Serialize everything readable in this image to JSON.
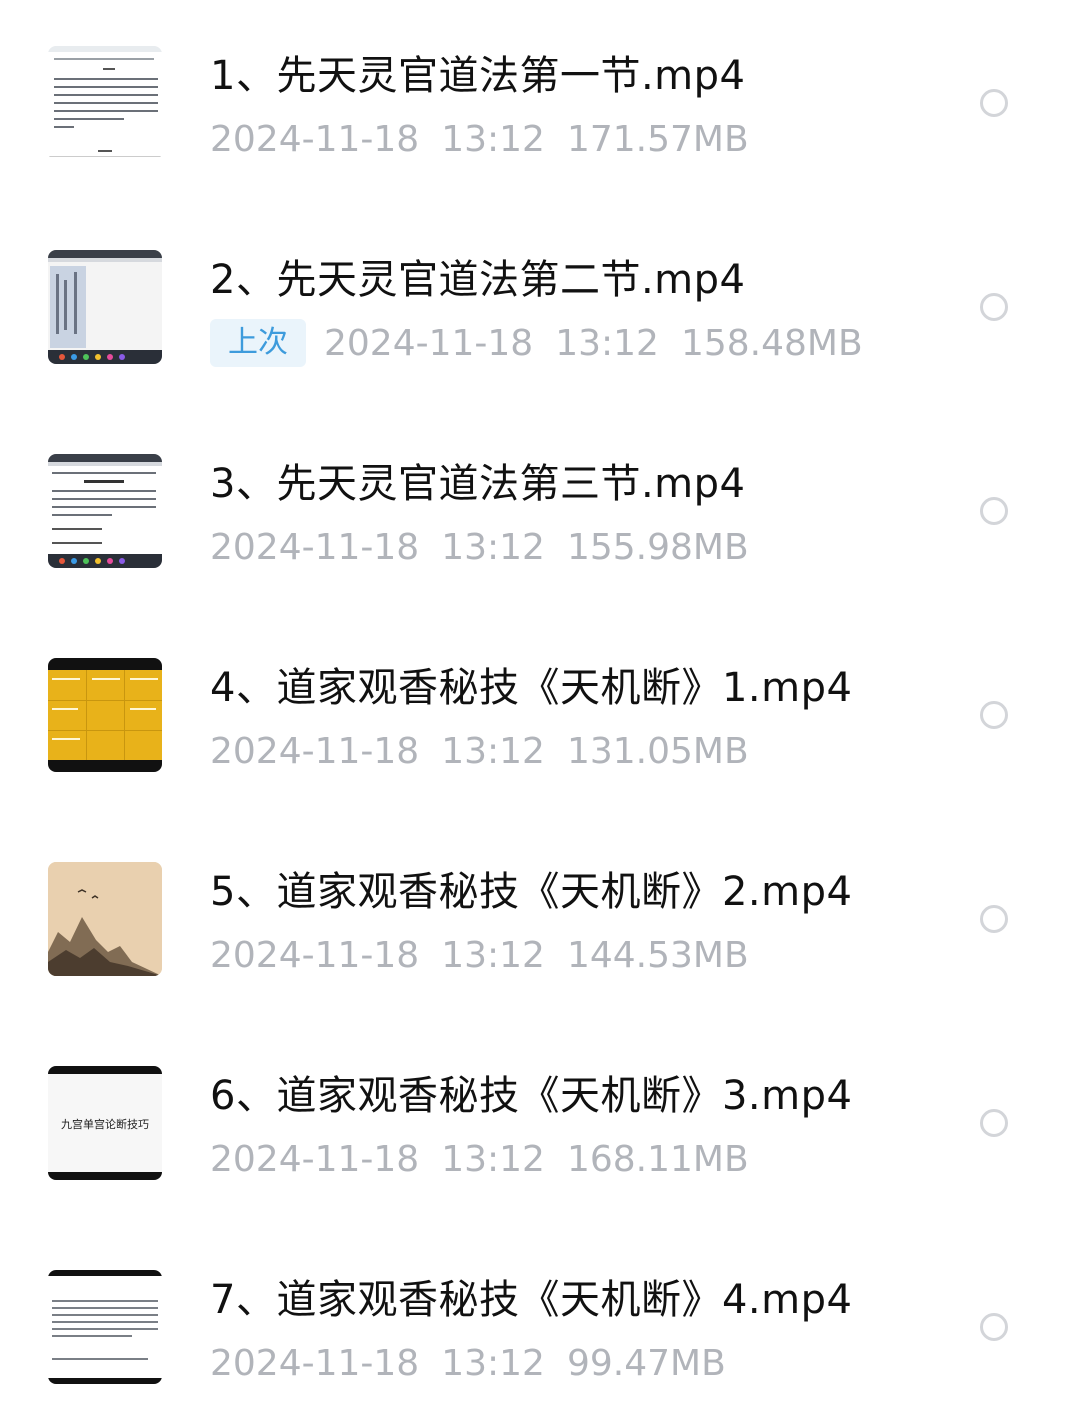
{
  "files": [
    {
      "name": "1、先天灵官道法第一节.mp4",
      "date": "2024-11-18",
      "time": "13:12",
      "size": "171.57MB"
    },
    {
      "name": "2、先天灵官道法第二节.mp4",
      "badge": "上次",
      "date": "2024-11-18",
      "time": "13:12",
      "size": "158.48MB"
    },
    {
      "name": "3、先天灵官道法第三节.mp4",
      "date": "2024-11-18",
      "time": "13:12",
      "size": "155.98MB"
    },
    {
      "name": "4、道家观香秘技《天机断》1.mp4",
      "date": "2024-11-18",
      "time": "13:12",
      "size": "131.05MB"
    },
    {
      "name": "5、道家观香秘技《天机断》2.mp4",
      "date": "2024-11-18",
      "time": "13:12",
      "size": "144.53MB"
    },
    {
      "name": "6、道家观香秘技《天机断》3.mp4",
      "date": "2024-11-18",
      "time": "13:12",
      "size": "168.11MB",
      "thumb_text": "九宫单宫论断技巧"
    },
    {
      "name": "7、道家观香秘技《天机断》4.mp4",
      "date": "2024-11-18",
      "time": "13:12",
      "size": "99.47MB"
    }
  ],
  "colors": {
    "title": "#111111",
    "meta": "#b1b4ba",
    "badge_bg": "#eaf4fb",
    "badge_text": "#3d9bdc",
    "circle": "#d3d5d9",
    "thumb_yellow": "#e8b21a",
    "thumb_paper": "#e3c9a5"
  }
}
